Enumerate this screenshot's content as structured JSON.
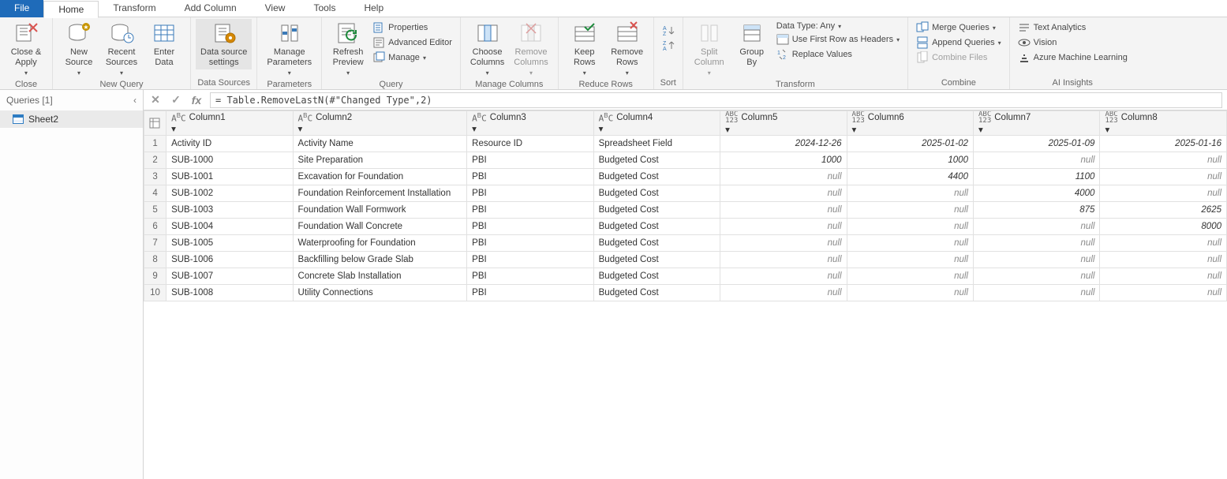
{
  "menubar": {
    "file": "File",
    "home": "Home",
    "transform": "Transform",
    "addColumn": "Add Column",
    "view": "View",
    "tools": "Tools",
    "help": "Help"
  },
  "ribbon": {
    "close": {
      "closeApply": "Close &\nApply",
      "group": "Close"
    },
    "newQuery": {
      "newSource": "New\nSource",
      "recentSources": "Recent\nSources",
      "enterData": "Enter\nData",
      "group": "New Query"
    },
    "dataSources": {
      "settings": "Data source\nsettings",
      "group": "Data Sources"
    },
    "parameters": {
      "manage": "Manage\nParameters",
      "group": "Parameters"
    },
    "query": {
      "refresh": "Refresh\nPreview",
      "properties": "Properties",
      "advEditor": "Advanced Editor",
      "manage": "Manage",
      "group": "Query"
    },
    "manageColumns": {
      "choose": "Choose\nColumns",
      "remove": "Remove\nColumns",
      "group": "Manage Columns"
    },
    "reduceRows": {
      "keep": "Keep\nRows",
      "remove": "Remove\nRows",
      "group": "Reduce Rows"
    },
    "sort": {
      "group": "Sort"
    },
    "transform": {
      "split": "Split\nColumn",
      "groupBy": "Group\nBy",
      "dataType": "Data Type: Any",
      "firstRow": "Use First Row as Headers",
      "replace": "Replace Values",
      "group": "Transform"
    },
    "combine": {
      "merge": "Merge Queries",
      "append": "Append Queries",
      "files": "Combine Files",
      "group": "Combine"
    },
    "ai": {
      "text": "Text Analytics",
      "vision": "Vision",
      "aml": "Azure Machine Learning",
      "group": "AI Insights"
    }
  },
  "sidebar": {
    "header": "Queries [1]",
    "items": [
      "Sheet2"
    ]
  },
  "formula": "= Table.RemoveLastN(#\"Changed Type\",2)",
  "columns": [
    {
      "name": "Column1",
      "type": "text"
    },
    {
      "name": "Column2",
      "type": "text"
    },
    {
      "name": "Column3",
      "type": "text"
    },
    {
      "name": "Column4",
      "type": "text"
    },
    {
      "name": "Column5",
      "type": "generic"
    },
    {
      "name": "Column6",
      "type": "generic"
    },
    {
      "name": "Column7",
      "type": "generic"
    },
    {
      "name": "Column8",
      "type": "generic"
    }
  ],
  "rows": [
    [
      "Activity ID",
      "Activity Name",
      "Resource ID",
      "Spreadsheet Field",
      "2024-12-26",
      "2025-01-02",
      "2025-01-09",
      "2025-01-16"
    ],
    [
      "SUB-1000",
      "Site Preparation",
      "PBI",
      "Budgeted Cost",
      "1000",
      "1000",
      null,
      null
    ],
    [
      "SUB-1001",
      "Excavation for Foundation",
      "PBI",
      "Budgeted Cost",
      null,
      "4400",
      "1100",
      null
    ],
    [
      "SUB-1002",
      "Foundation Reinforcement Installation",
      "PBI",
      "Budgeted Cost",
      null,
      null,
      "4000",
      null
    ],
    [
      "SUB-1003",
      "Foundation Wall Formwork",
      "PBI",
      "Budgeted Cost",
      null,
      null,
      "875",
      "2625"
    ],
    [
      "SUB-1004",
      "Foundation Wall Concrete",
      "PBI",
      "Budgeted Cost",
      null,
      null,
      null,
      "8000"
    ],
    [
      "SUB-1005",
      "Waterproofing for Foundation",
      "PBI",
      "Budgeted Cost",
      null,
      null,
      null,
      null
    ],
    [
      "SUB-1006",
      "Backfilling below Grade Slab",
      "PBI",
      "Budgeted Cost",
      null,
      null,
      null,
      null
    ],
    [
      "SUB-1007",
      "Concrete Slab Installation",
      "PBI",
      "Budgeted Cost",
      null,
      null,
      null,
      null
    ],
    [
      "SUB-1008",
      "Utility Connections",
      "PBI",
      "Budgeted Cost",
      null,
      null,
      null,
      null
    ]
  ]
}
